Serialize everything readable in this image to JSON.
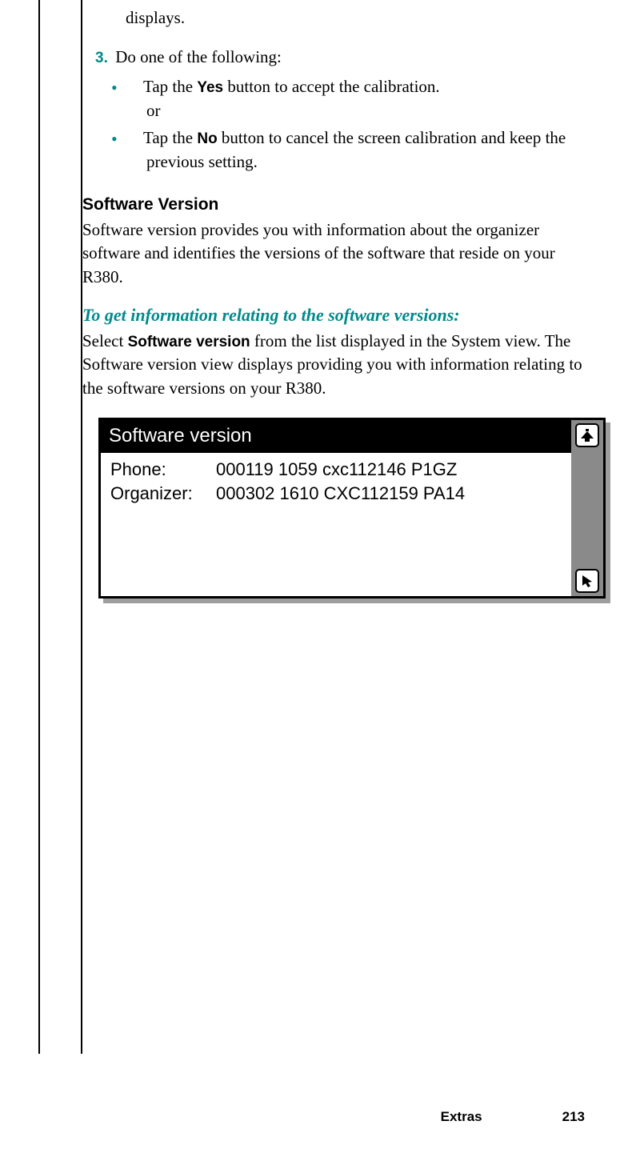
{
  "top_fragment": "displays.",
  "step": {
    "number": "3.",
    "text": "Do one of the following:"
  },
  "bullets": [
    {
      "pre": "Tap the ",
      "btn": "Yes",
      "post": " button to accept the calibration.",
      "tail": "or"
    },
    {
      "pre": "Tap the ",
      "btn": "No",
      "post": " button to cancel the screen calibration and keep the previous setting."
    }
  ],
  "section": {
    "heading": "Software Version",
    "para": "Software version provides you with information about the organizer software and identifies the versions of the software that reside on your R380."
  },
  "howto": {
    "heading": "To get information relating to the software versions:",
    "pre": "Select ",
    "bold": "Software version",
    "post": " from the list displayed in the System view. The Software version view displays providing you with information relating to the software versions on your R380."
  },
  "screenshot": {
    "title": "Software version",
    "rows": [
      {
        "label": "Phone:",
        "value": "000119 1059 cxc112146 P1GZ"
      },
      {
        "label": "Organizer:",
        "value": "000302 1610 CXC112159 PA14"
      }
    ]
  },
  "footer": {
    "section": "Extras",
    "page": "213"
  }
}
